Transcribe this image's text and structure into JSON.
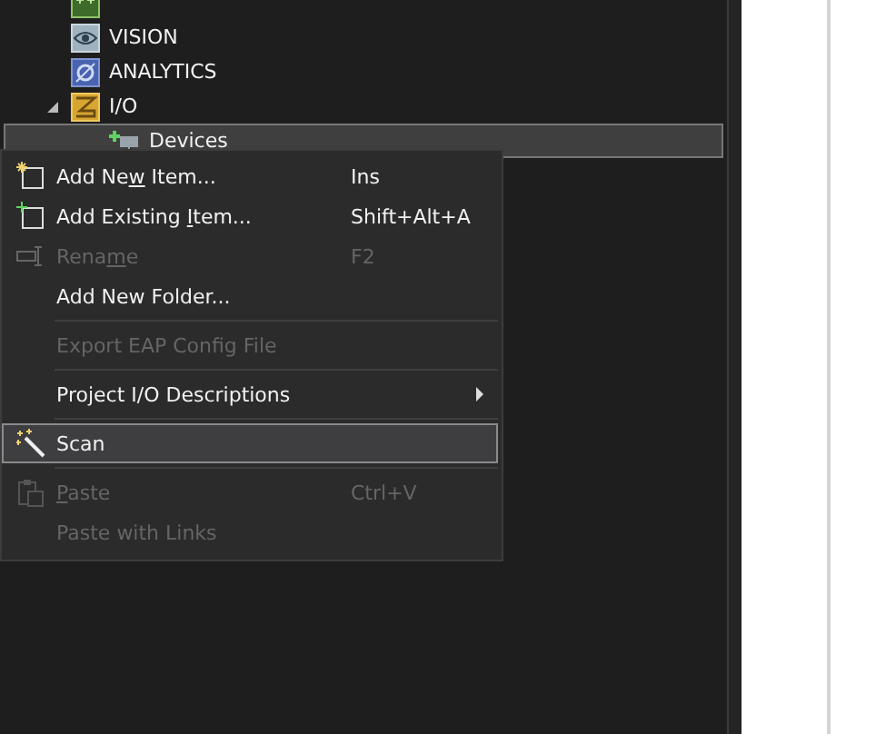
{
  "tree": {
    "items": [
      {
        "kind": "cpp"
      },
      {
        "label": "VISION",
        "kind": "vision",
        "selected": false
      },
      {
        "label": "ANALYTICS",
        "kind": "analytics",
        "selected": false
      },
      {
        "label": "I/O",
        "kind": "io",
        "expanded": true,
        "selected": false,
        "children": [
          {
            "label": "Devices",
            "kind": "devices",
            "selected": true
          }
        ]
      }
    ]
  },
  "context_menu": {
    "items": [
      {
        "kind": "item",
        "label": "Add New Item...",
        "shortcut": "Ins",
        "disabled": false,
        "selected": false
      },
      {
        "kind": "item",
        "label": "Add Existing Item...",
        "shortcut": "Shift+Alt+A",
        "disabled": false,
        "selected": false
      },
      {
        "kind": "item",
        "label": "Rename",
        "shortcut": "F2",
        "disabled": true,
        "selected": false
      },
      {
        "kind": "item",
        "label": "Add New Folder...",
        "disabled": false,
        "selected": false
      },
      {
        "kind": "separator"
      },
      {
        "kind": "item",
        "label": "Export EAP Config File",
        "disabled": true,
        "selected": false
      },
      {
        "kind": "separator"
      },
      {
        "kind": "submenu",
        "label": "Project I/O Descriptions",
        "disabled": false,
        "selected": false
      },
      {
        "kind": "separator"
      },
      {
        "kind": "item",
        "label": "Scan",
        "disabled": false,
        "selected": true
      },
      {
        "kind": "separator"
      },
      {
        "kind": "item",
        "label": "Paste",
        "shortcut": "Ctrl+V",
        "disabled": true,
        "selected": false
      },
      {
        "kind": "item",
        "label": "Paste with Links",
        "disabled": true,
        "selected": false
      }
    ]
  }
}
